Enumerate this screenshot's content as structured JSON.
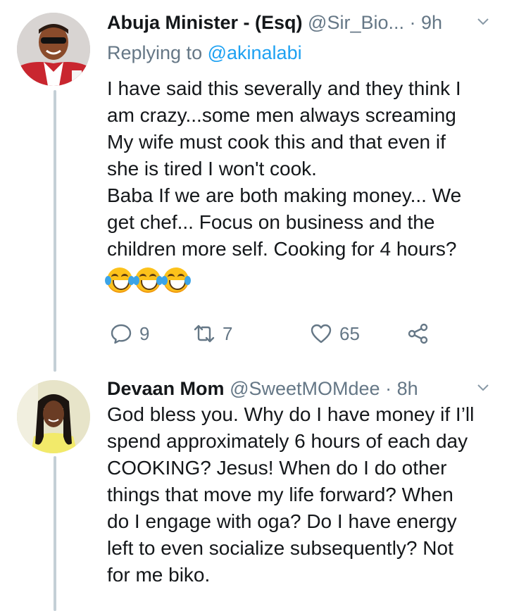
{
  "tweets": [
    {
      "name": "Abuja Minister - (Esq)",
      "handle": "@Sir_Bio...",
      "dot": "·",
      "time": "9h",
      "replying_prefix": "Replying to ",
      "replying_to": "@akinalabi",
      "body": "I have said this severally and they think I\nam crazy...some men always screaming\nMy wife must cook this and that even if\nshe is tired I won't cook.\nBaba If we are both making money... We\nget chef... Focus on business and the\nchildren more self. Cooking for 4 hours?",
      "emojis": [
        "face-with-tears-of-joy",
        "face-with-tears-of-joy",
        "face-with-tears-of-joy"
      ],
      "actions": {
        "replies": "9",
        "retweets": "7",
        "likes": "65"
      }
    },
    {
      "name": "Devaan Mom",
      "handle": "@SweetMOMdee",
      "dot": "·",
      "time": "8h",
      "body": "God bless you. Why do I have money if I’ll\nspend approximately 6 hours of each day\nCOOKING? Jesus! When do I do other\nthings that move my life forward? When\ndo I engage with oga? Do I have energy\nleft to even socialize subsequently? Not\nfor me biko."
    }
  ],
  "colors": {
    "text": "#14171a",
    "secondary": "#657786",
    "accent": "#1da1f2",
    "thread_line": "#c4cfd6"
  }
}
